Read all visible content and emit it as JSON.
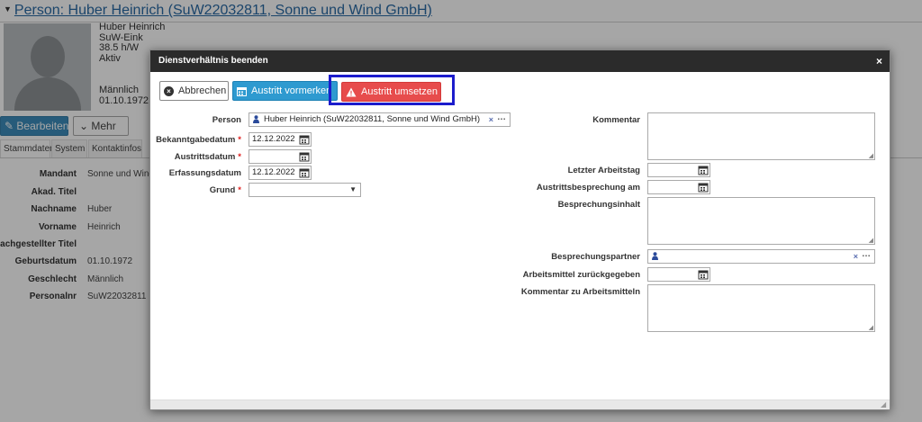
{
  "background": {
    "page_title": "Person: Huber Heinrich (SuW22032811, Sonne und Wind GmbH)",
    "person_info": [
      "Huber Heinrich",
      "SuW-Eink",
      "38.5 h/W",
      "Aktiv"
    ],
    "person_info2": [
      "Männlich",
      "01.10.1972"
    ],
    "buttons": {
      "edit": "Bearbeiten",
      "more": "Mehr"
    },
    "tabs": [
      "Stammdaten",
      "System",
      "Kontaktinfos"
    ],
    "fields": [
      {
        "label": "Mandant",
        "value": "Sonne und Wind G"
      },
      {
        "label": "Akad. Titel",
        "value": ""
      },
      {
        "label": "Nachname",
        "value": "Huber"
      },
      {
        "label": "Vorname",
        "value": "Heinrich"
      },
      {
        "label": "Nachgestellter Titel",
        "value": ""
      },
      {
        "label": "Geburtsdatum",
        "value": "01.10.1972"
      },
      {
        "label": "Geschlecht",
        "value": "Männlich"
      },
      {
        "label": "Personalnr",
        "value": "SuW22032811"
      }
    ]
  },
  "modal": {
    "title": "Dienstverhältnis beenden",
    "close": "×",
    "buttons": {
      "cancel": "Abbrechen",
      "mark": "Austritt vormerken",
      "execute": "Austritt umsetzen"
    },
    "left": {
      "person_label": "Person",
      "person_value": "Huber Heinrich (SuW22032811, Sonne und Wind GmbH)",
      "bekanntgabe_label": "Bekanntgabedatum",
      "bekanntgabe_value": "12.12.2022",
      "austritt_label": "Austrittsdatum",
      "austritt_value": "",
      "erfassung_label": "Erfassungsdatum",
      "erfassung_value": "12.12.2022",
      "grund_label": "Grund",
      "grund_value": ""
    },
    "right": {
      "kommentar_label": "Kommentar",
      "letzter_label": "Letzter Arbeitstag",
      "besprechung_am_label": "Austrittsbesprechung am",
      "inhalt_label": "Besprechungsinhalt",
      "partner_label": "Besprechungspartner",
      "arbeitsmittel_label": "Arbeitsmittel zurückgegeben",
      "kommentar_am_label": "Kommentar zu Arbeitsmitteln"
    },
    "required_mark": "*"
  },
  "colors": {
    "primary": "#2e9ad0",
    "danger": "#e74c4c",
    "highlight": "#1c1ccc",
    "header": "#2b2b2b"
  }
}
